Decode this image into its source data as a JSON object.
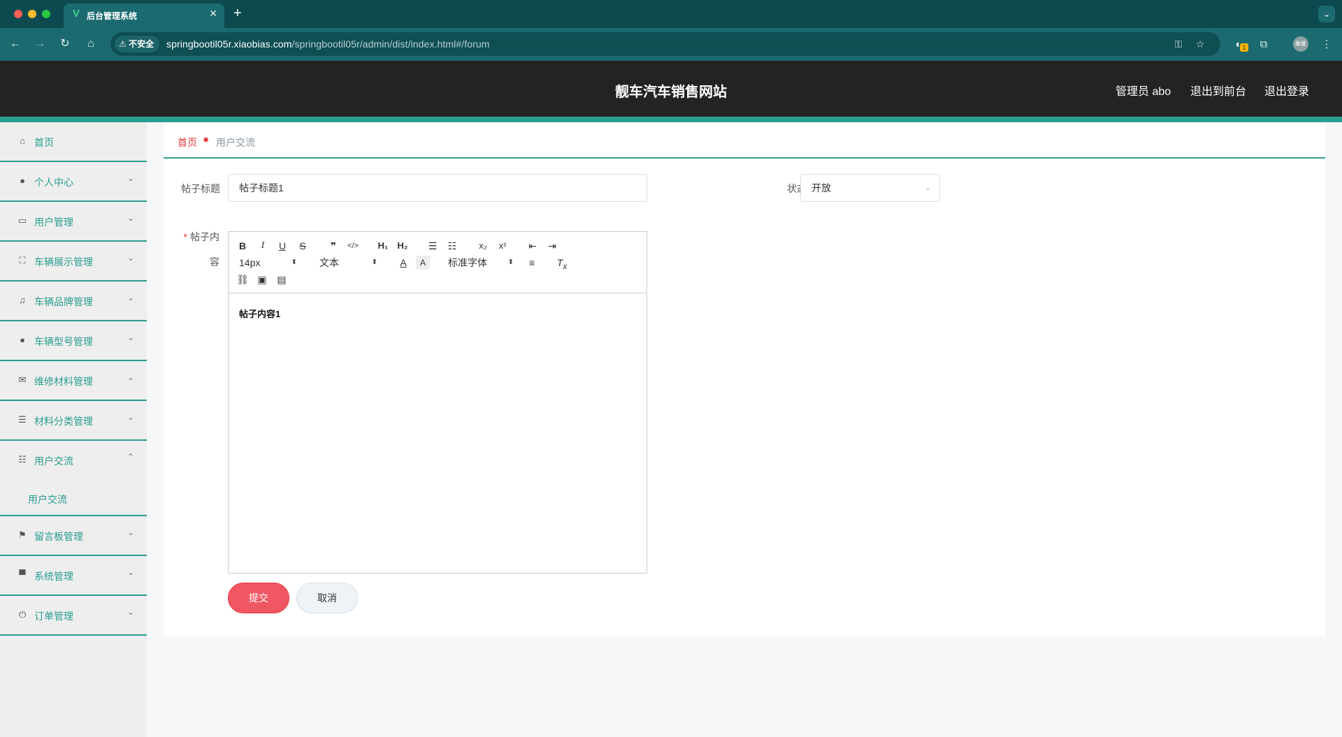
{
  "browser": {
    "tab_title": "后台管理系统",
    "tab_favicon": "vue-logo-icon",
    "new_tab": "+",
    "insecure_label": "不安全",
    "url_host": "springbootil05r.xiaobias.com",
    "url_path": "/springbootil05r/admin/dist/index.html#/forum",
    "extension_badge": "1",
    "profile_label": "敢敢"
  },
  "header": {
    "site_title": "靓车汽车销售网站",
    "admin_label": "管理员 abo",
    "to_frontend": "退出到前台",
    "logout": "退出登录"
  },
  "sidebar": {
    "items": [
      {
        "label": "首页",
        "icon": "home-icon"
      },
      {
        "label": "个人中心",
        "icon": "user-icon"
      },
      {
        "label": "用户管理",
        "icon": "chat-icon"
      },
      {
        "label": "车辆展示管理",
        "icon": "fullscreen-icon"
      },
      {
        "label": "车辆品牌管理",
        "icon": "bell-off-icon"
      },
      {
        "label": "车辆型号管理",
        "icon": "balloon-icon"
      },
      {
        "label": "维修材料管理",
        "icon": "mail-icon"
      },
      {
        "label": "材料分类管理",
        "icon": "list-icon"
      },
      {
        "label": "用户交流",
        "icon": "sliders-icon"
      },
      {
        "label": "留言板管理",
        "icon": "flag-icon"
      },
      {
        "label": "系统管理",
        "icon": "brush-icon"
      },
      {
        "label": "订单管理",
        "icon": "power-icon"
      }
    ],
    "sub_item": "用户交流"
  },
  "breadcrumb": {
    "home": "首页",
    "current": "用户交流"
  },
  "form": {
    "title_label": "帖子标题",
    "title_value": "帖子标题1",
    "status_label": "状态",
    "status_value": "开放",
    "content_label_line1": "帖子内",
    "content_label_line2": "容",
    "content_value": "帖子内容1",
    "submit_label": "提交",
    "cancel_label": "取消"
  },
  "editor": {
    "font_size": "14px",
    "header_select": "文本",
    "font_family": "标准字体"
  },
  "colors": {
    "accent": "#2a9d8f",
    "danger": "#e8373a",
    "header_bg": "#232323"
  }
}
